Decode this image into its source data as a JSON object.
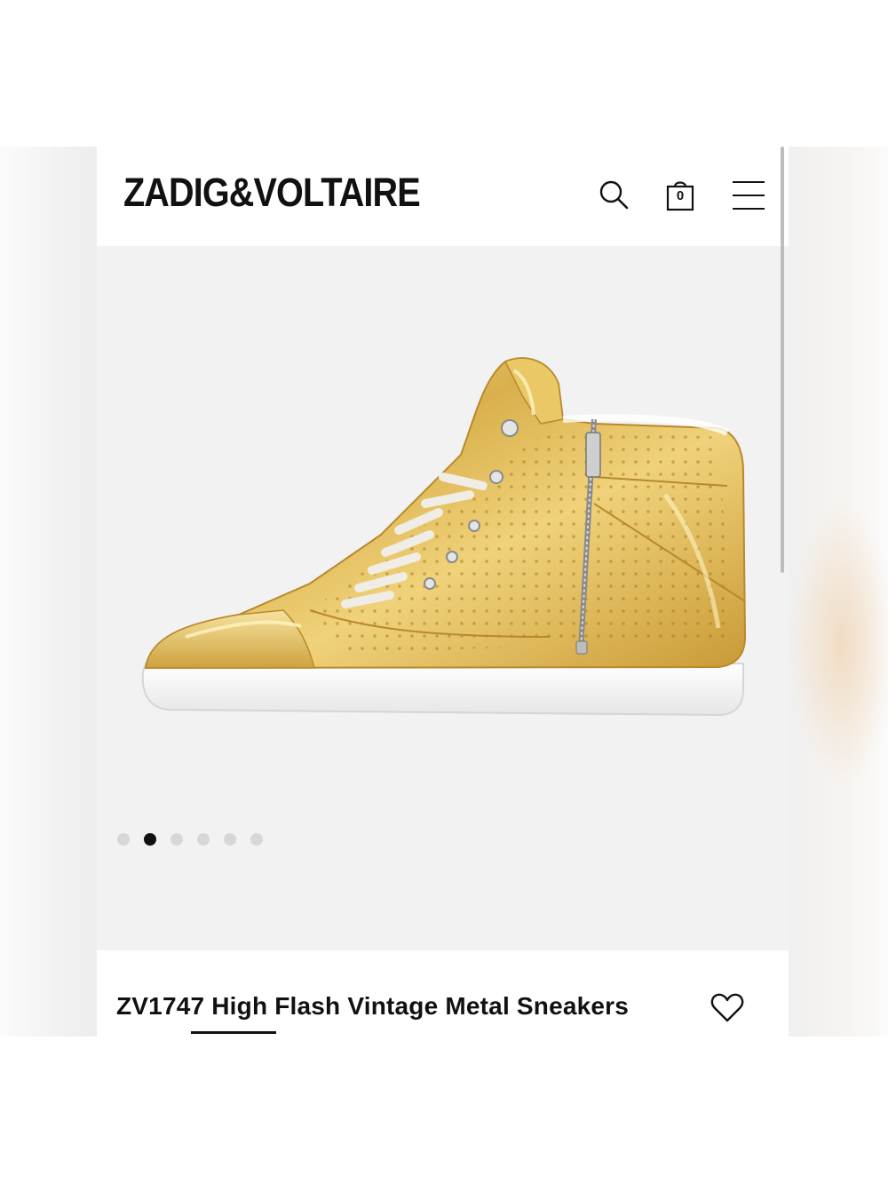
{
  "header": {
    "logo_text": "ZADIG&VOLTAIRE",
    "search_icon": "search-icon",
    "bag_icon": "shopping-bag-icon",
    "bag_count": "0",
    "menu_icon": "hamburger-menu-icon"
  },
  "gallery": {
    "image_subject": "gold metallic perforated high-top sneaker with side zip and white sole",
    "dots_total": 6,
    "active_dot": 2
  },
  "product": {
    "title": "ZV1747 High Flash Vintage Metal Sneakers",
    "wishlist_icon": "heart-icon"
  },
  "colors": {
    "text": "#111111",
    "gallery_bg": "#f2f2f2",
    "gold": "#d8b24e",
    "dot_inactive": "#d7d7d7"
  }
}
